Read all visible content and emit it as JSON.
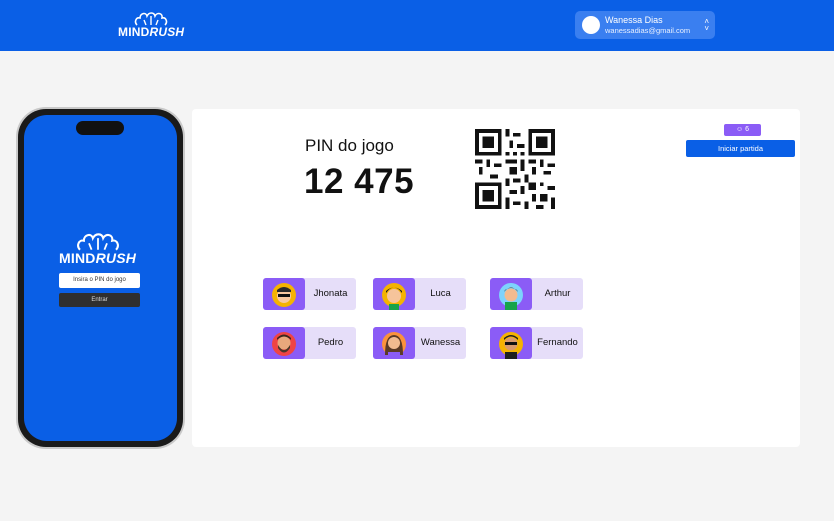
{
  "header": {
    "logo_text_1": "MIND",
    "logo_text_2": "RUSH",
    "user_name": "Wanessa Dias",
    "user_email": "wanessadias@gmail.com"
  },
  "phone": {
    "logo_text_1": "MIND",
    "logo_text_2": "RUSH",
    "pin_placeholder": "Insira o PIN do jogo",
    "enter_label": "Entrar"
  },
  "lobby": {
    "pin_label": "PIN do jogo",
    "pin_value": "12 475",
    "player_count": "6",
    "start_label": "Iniciar partida",
    "players": [
      {
        "name": "Jhonata",
        "avatar_bg": "#f5b301"
      },
      {
        "name": "Luca",
        "avatar_bg": "#f5b301"
      },
      {
        "name": "Arthur",
        "avatar_bg": "#7dd3fc"
      },
      {
        "name": "Pedro",
        "avatar_bg": "#ef4444"
      },
      {
        "name": "Wanessa",
        "avatar_bg": "#fb923c"
      },
      {
        "name": "Fernando",
        "avatar_bg": "#f5b301"
      }
    ]
  },
  "colors": {
    "primary": "#0a5fe6",
    "accent": "#8b5cf6",
    "player_card": "#e6def9",
    "page_bg": "#f4f4f4"
  }
}
